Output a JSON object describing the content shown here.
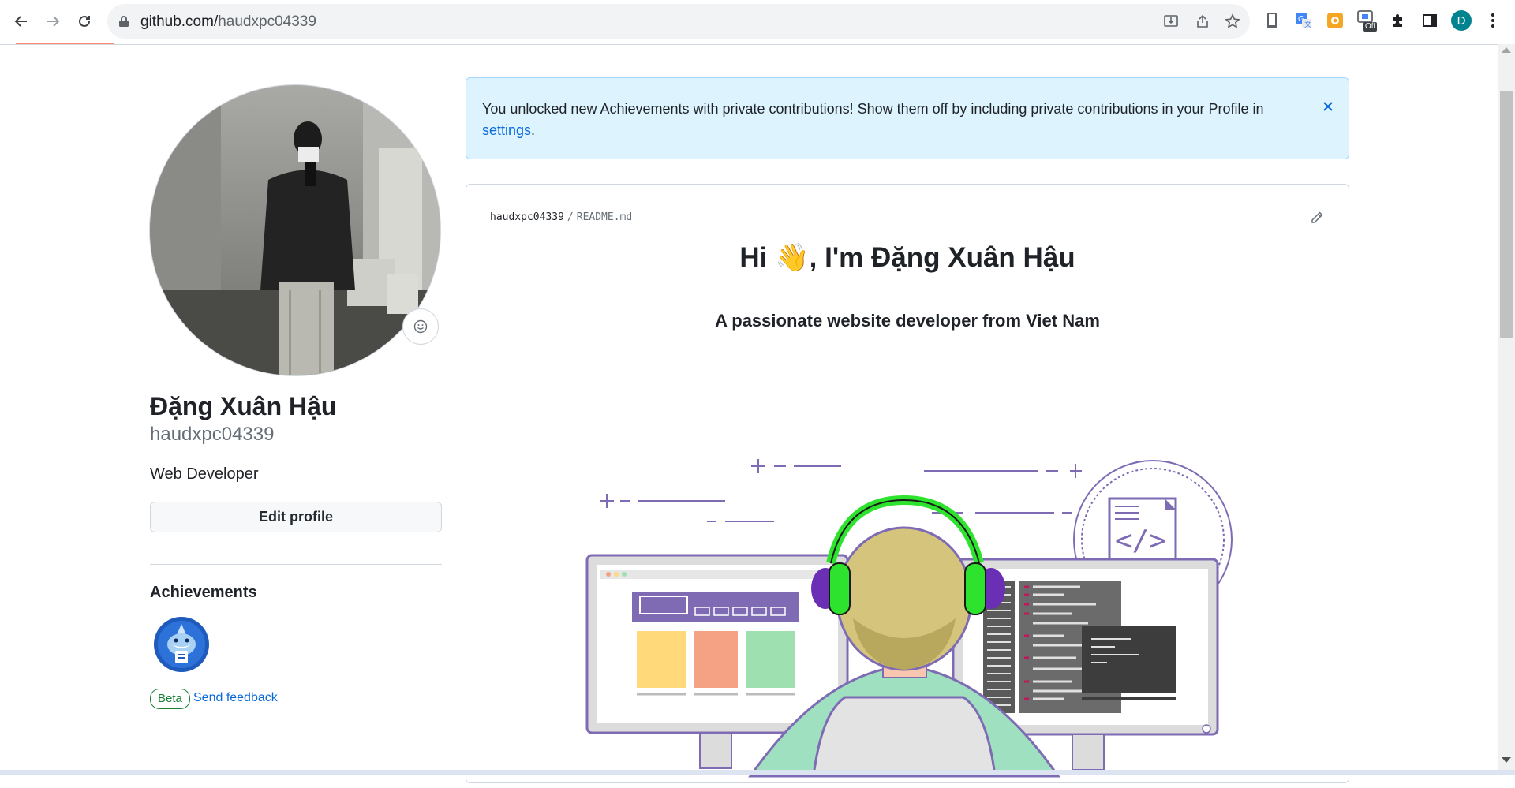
{
  "browser": {
    "url_host": "github.com/",
    "url_path": "haudxpc04339",
    "profile_initial": "D",
    "ext_badge": "Off"
  },
  "flash": {
    "message": "You unlocked new Achievements with private contributions! Show them off by including private contributions in your Profile in",
    "link": "settings",
    "period": "."
  },
  "profile": {
    "fullname": "Đặng Xuân Hậu",
    "username": "haudxpc04339",
    "bio": "Web Developer",
    "edit_label": "Edit profile",
    "achievements_title": "Achievements",
    "beta_label": "Beta",
    "feedback_label": "Send feedback"
  },
  "readme": {
    "owner": "haudxpc04339",
    "separator": "/",
    "file": "README.md",
    "heading": "Hi 👋, I'm Đặng Xuân Hậu",
    "subheading": "A passionate website developer from Viet Nam"
  },
  "colors": {
    "link": "#0969da",
    "flash_bg": "#ddf4ff",
    "beta": "#1a7f37",
    "headphone": "#2ee32e",
    "code_accent": "#7e6bb4"
  }
}
